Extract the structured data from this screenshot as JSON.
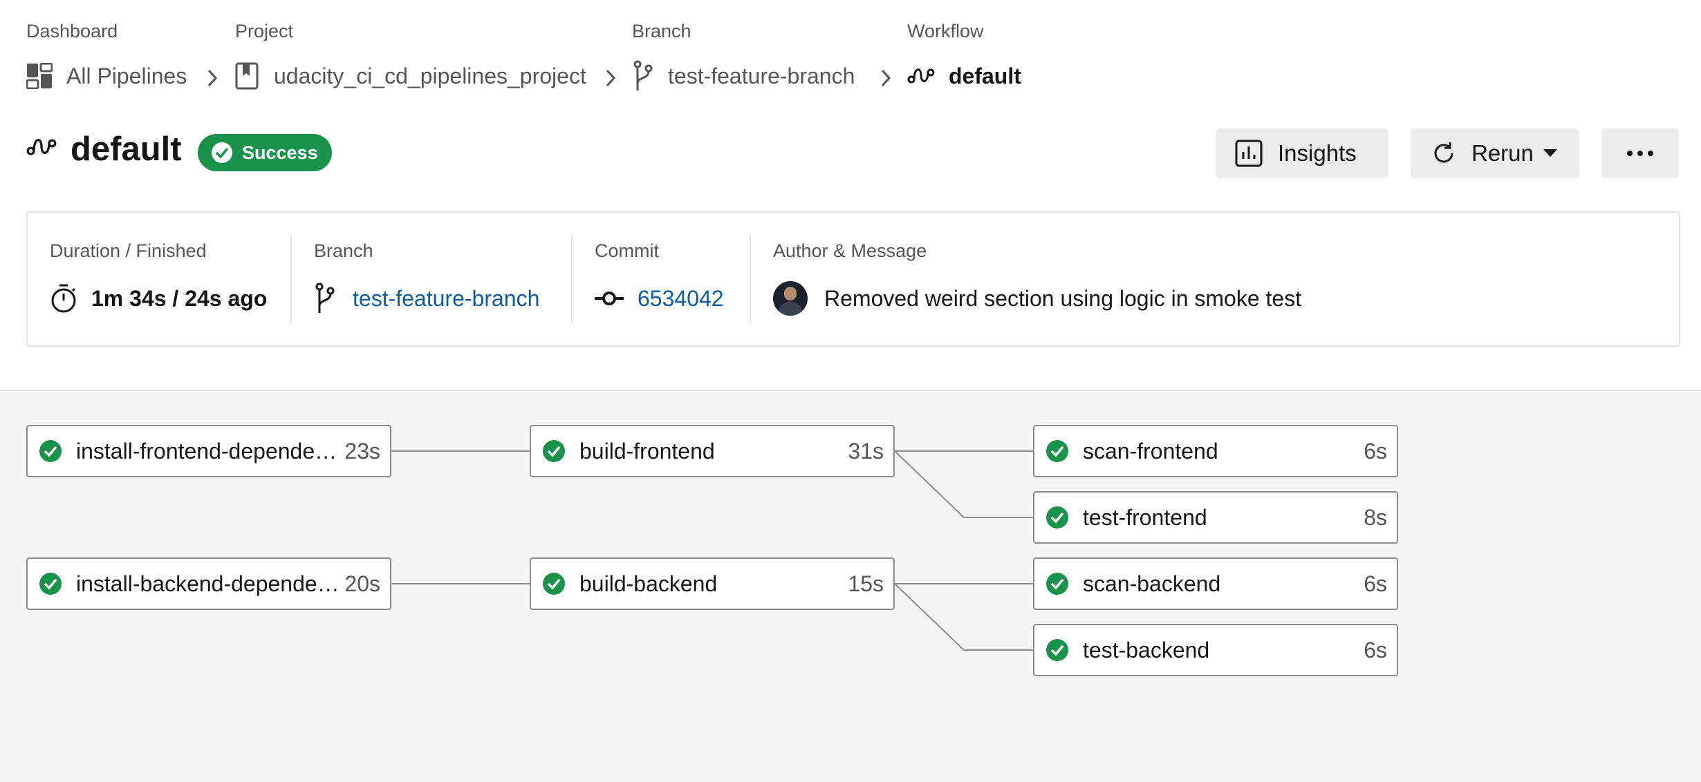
{
  "breadcrumb": {
    "dashboard": {
      "heading": "Dashboard",
      "label": "All Pipelines",
      "icon": "dashboard-grid-icon"
    },
    "project": {
      "heading": "Project",
      "label": "udacity_ci_cd_pipelines_project",
      "icon": "bookmark-icon"
    },
    "branch": {
      "heading": "Branch",
      "label": "test-feature-branch",
      "icon": "git-branch-icon"
    },
    "workflow": {
      "heading": "Workflow",
      "label": "default",
      "icon": "workflow-icon"
    }
  },
  "header": {
    "title": "default",
    "status": "Success",
    "status_color": "#19924b",
    "insights_label": "Insights",
    "rerun_label": "Rerun",
    "more_label": "•••"
  },
  "summary": {
    "duration_label": "Duration / Finished",
    "duration_value": "1m 34s / 24s ago",
    "branch_label": "Branch",
    "branch_value": "test-feature-branch",
    "commit_label": "Commit",
    "commit_value": "6534042",
    "author_label": "Author & Message",
    "message": "Removed weird section using logic in smoke test"
  },
  "jobs": [
    {
      "name": "install-frontend-dependencies",
      "duration": "23s",
      "status": "success"
    },
    {
      "name": "build-frontend",
      "duration": "31s",
      "status": "success"
    },
    {
      "name": "scan-frontend",
      "duration": "6s",
      "status": "success"
    },
    {
      "name": "test-frontend",
      "duration": "8s",
      "status": "success"
    },
    {
      "name": "install-backend-dependencies",
      "duration": "20s",
      "status": "success"
    },
    {
      "name": "build-backend",
      "duration": "15s",
      "status": "success"
    },
    {
      "name": "scan-backend",
      "duration": "6s",
      "status": "success"
    },
    {
      "name": "test-backend",
      "duration": "6s",
      "status": "success"
    }
  ],
  "colors": {
    "accent_link": "#0c5ba6",
    "success": "#19924b",
    "canvas_bg": "#f5f5f5"
  }
}
